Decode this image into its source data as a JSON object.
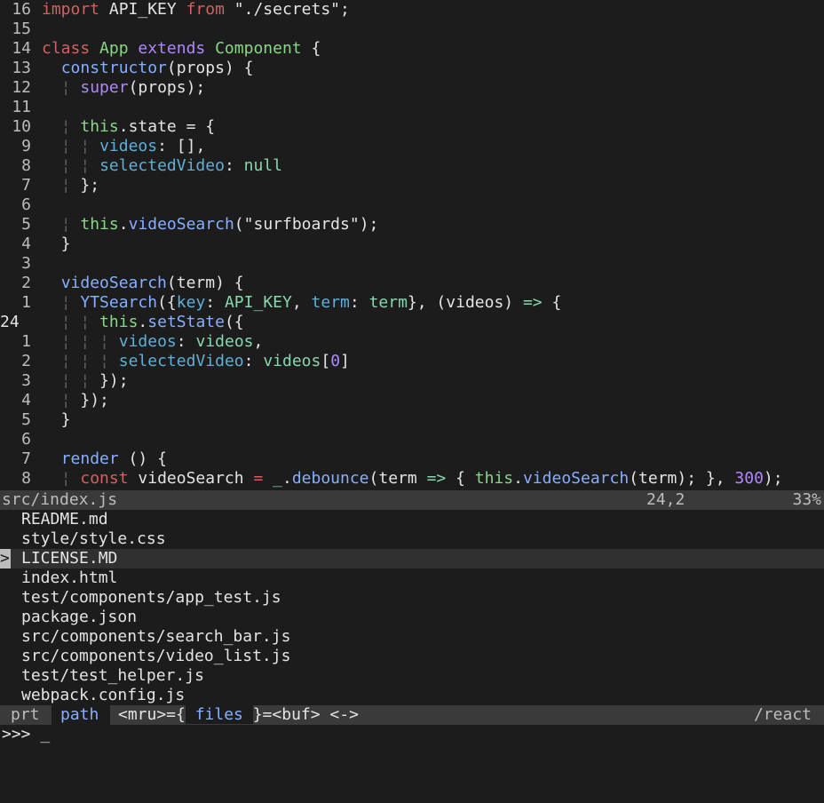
{
  "editor": {
    "lines": [
      {
        "n": "16",
        "cur": false,
        "html": "<span class=\"kw\">import</span> API_KEY <span class=\"kw\">from</span> <span class=\"str\">\"./secrets\"</span>;"
      },
      {
        "n": "15",
        "cur": false,
        "html": ""
      },
      {
        "n": "14",
        "cur": false,
        "html": "<span class=\"kw\">class</span> <span class=\"cls\">App</span> <span class=\"kw2\">extends</span> <span class=\"cls\">Component</span> {"
      },
      {
        "n": "13",
        "cur": false,
        "html": "  <span class=\"fn\">constructor</span>(props) {"
      },
      {
        "n": "12",
        "cur": false,
        "html": "  <span class=\"guide\">¦</span> <span class=\"kw2\">super</span>(props);"
      },
      {
        "n": "11",
        "cur": false,
        "html": ""
      },
      {
        "n": "10",
        "cur": false,
        "html": "  <span class=\"guide\">¦</span> <span class=\"cls\">this</span>.state = {"
      },
      {
        "n": "9",
        "cur": false,
        "html": "  <span class=\"guide\">¦</span> <span class=\"guide\">¦</span> <span class=\"prop\">videos</span>: [],"
      },
      {
        "n": "8",
        "cur": false,
        "html": "  <span class=\"guide\">¦</span> <span class=\"guide\">¦</span> <span class=\"prop\">selectedVideo</span>: <span class=\"ident\">null</span>"
      },
      {
        "n": "7",
        "cur": false,
        "html": "  <span class=\"guide\">¦</span> };"
      },
      {
        "n": "6",
        "cur": false,
        "html": ""
      },
      {
        "n": "5",
        "cur": false,
        "html": "  <span class=\"guide\">¦</span> <span class=\"cls\">this</span>.<span class=\"fn\">videoSearch</span>(<span class=\"str\">\"surfboards\"</span>);"
      },
      {
        "n": "4",
        "cur": false,
        "html": "  }"
      },
      {
        "n": "3",
        "cur": false,
        "html": ""
      },
      {
        "n": "2",
        "cur": false,
        "html": "  <span class=\"fn\">videoSearch</span>(term) {"
      },
      {
        "n": "1",
        "cur": false,
        "html": "  <span class=\"guide\">¦</span> <span class=\"fn\">YTSearch</span>({<span class=\"prop\">key</span>: <span class=\"ident\">API_KEY</span>, <span class=\"prop\">term</span>: <span class=\"ident\">term</span>}, (videos) <span class=\"ident\">=&gt;</span> {"
      },
      {
        "n": "24",
        "cur": true,
        "html": "  <span class=\"guide\">¦</span> <span class=\"guide\">¦</span> <span class=\"cls\">this</span>.<span class=\"fn\">setState</span>({"
      },
      {
        "n": "1",
        "cur": false,
        "html": "  <span class=\"guide\">¦</span> <span class=\"guide\">¦</span> <span class=\"guide\">¦</span> <span class=\"prop\">videos</span>: <span class=\"ident\">videos</span>,"
      },
      {
        "n": "2",
        "cur": false,
        "html": "  <span class=\"guide\">¦</span> <span class=\"guide\">¦</span> <span class=\"guide\">¦</span> <span class=\"prop\">selectedVideo</span>: <span class=\"ident\">videos</span>[<span class=\"num\">0</span>]"
      },
      {
        "n": "3",
        "cur": false,
        "html": "  <span class=\"guide\">¦</span> <span class=\"guide\">¦</span> });"
      },
      {
        "n": "4",
        "cur": false,
        "html": "  <span class=\"guide\">¦</span> });"
      },
      {
        "n": "5",
        "cur": false,
        "html": "  }"
      },
      {
        "n": "6",
        "cur": false,
        "html": ""
      },
      {
        "n": "7",
        "cur": false,
        "html": "  <span class=\"fn\">render</span> () {"
      },
      {
        "n": "8",
        "cur": false,
        "html": "  <span class=\"guide\">¦</span> <span class=\"kw\">const</span> videoSearch <span class=\"kw\">=</span> <span class=\"ident\">_</span>.<span class=\"fn\">debounce</span>(term <span class=\"ident\">=&gt;</span> { <span class=\"cls\">this</span>.<span class=\"fn\">videoSearch</span>(term); }, <span class=\"num\">300</span>);"
      }
    ]
  },
  "status": {
    "filename": "src/index.js",
    "position": "24,2",
    "percent": "33%"
  },
  "ctrlp": {
    "files": [
      {
        "name": "README.md",
        "selected": false
      },
      {
        "name": "style/style.css",
        "selected": false
      },
      {
        "name": "LICENSE.MD",
        "selected": true
      },
      {
        "name": "index.html",
        "selected": false
      },
      {
        "name": "test/components/app_test.js",
        "selected": false
      },
      {
        "name": "package.json",
        "selected": false
      },
      {
        "name": "src/components/search_bar.js",
        "selected": false
      },
      {
        "name": "src/components/video_list.js",
        "selected": false
      },
      {
        "name": "test/test_helper.js",
        "selected": false
      },
      {
        "name": "webpack.config.js",
        "selected": false
      }
    ],
    "selected_marker": ">",
    "bar": {
      "prt": "prt",
      "path": "path",
      "mru_prefix": "<mru>={",
      "files_label": " files ",
      "buf_suffix": "}=<buf> <->",
      "dir": "/react"
    },
    "prompt": ">>> _"
  },
  "colors": {
    "background": "#1c1c1c",
    "keyword": "#d75f5f",
    "class": "#87d787",
    "function": "#87afff",
    "property": "#5fafd7",
    "statusline": "#3a3a3a"
  }
}
